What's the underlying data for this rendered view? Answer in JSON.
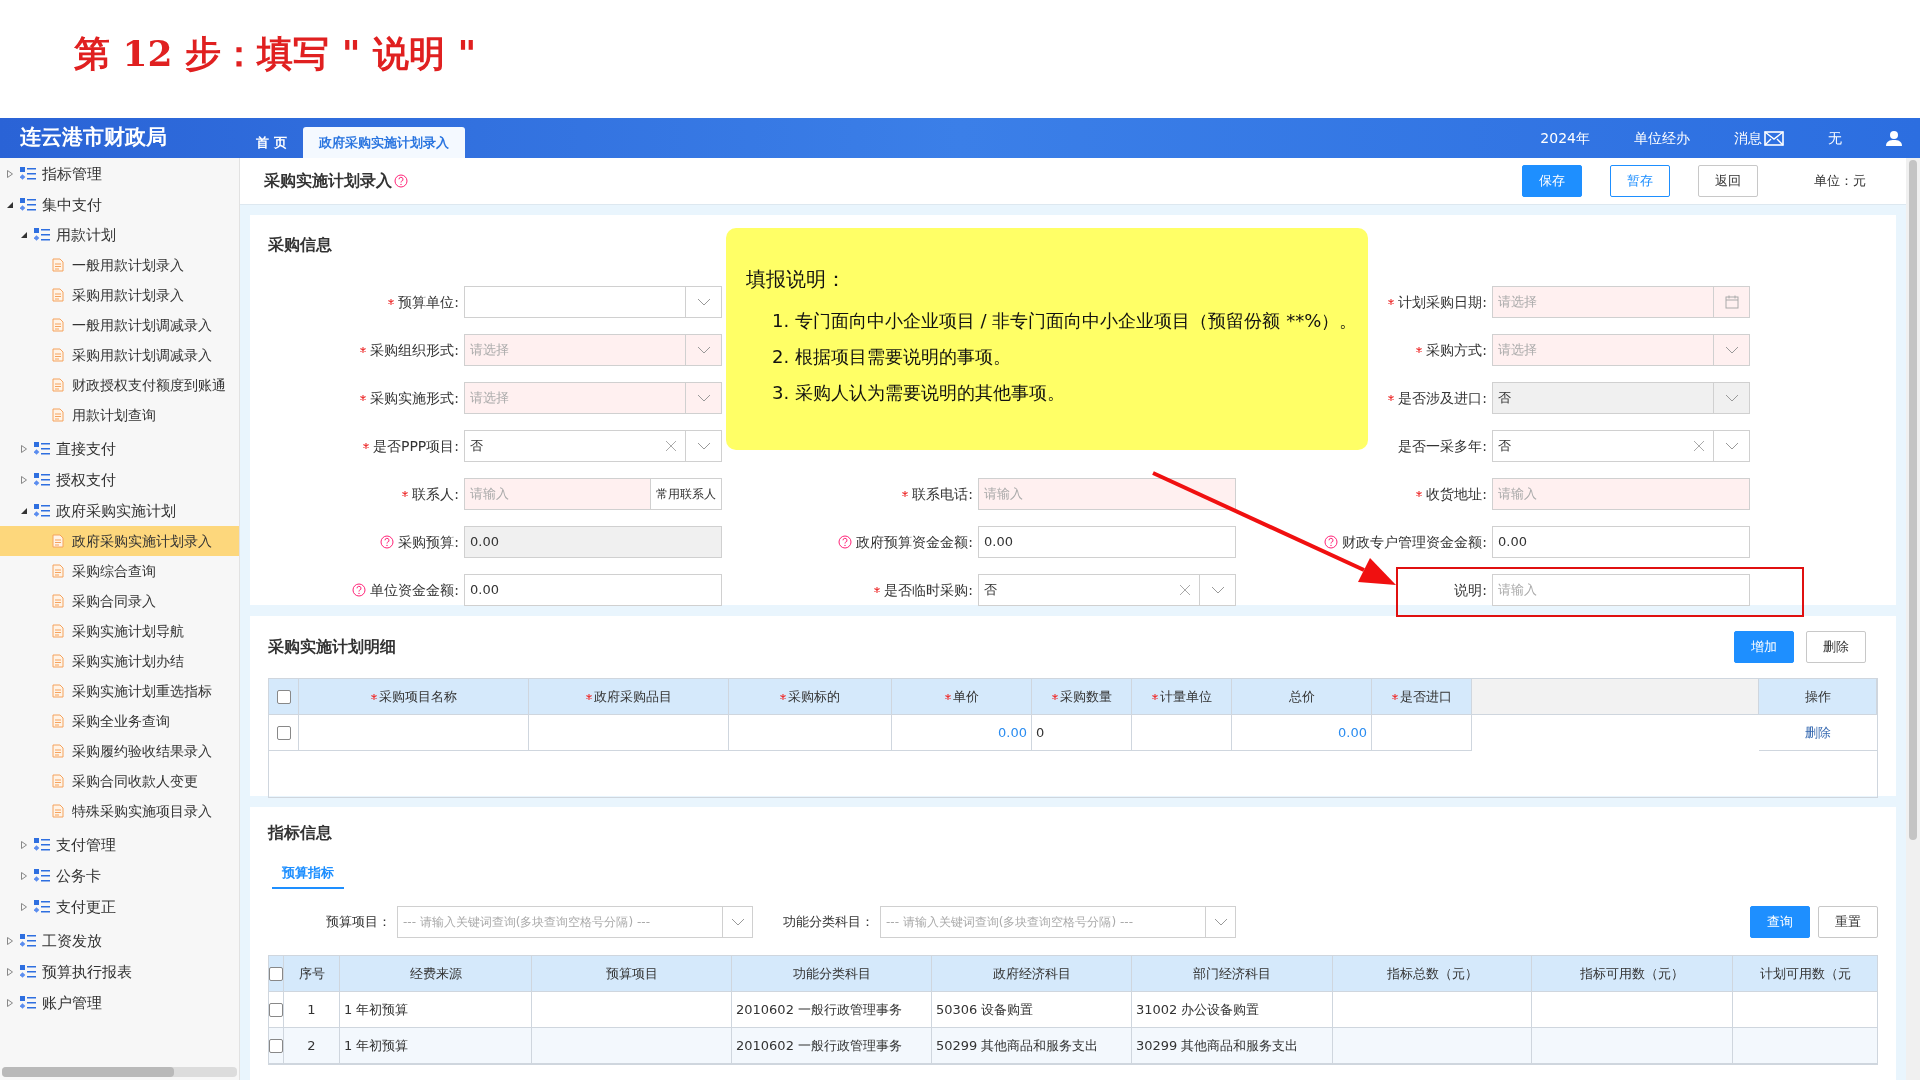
{
  "step_title": "第 12 步：填写 \" 说明 \"",
  "header": {
    "logo": "连云港市财政局",
    "tabs": [
      {
        "label": "首 页",
        "selected": false
      },
      {
        "label": "政府采购实施计划录入",
        "selected": true
      }
    ],
    "year": "2024年",
    "role": "单位经办",
    "messages": "消息",
    "extra": "无"
  },
  "sidebar": {
    "items": [
      {
        "label": "指标管理",
        "expanded": false
      },
      {
        "label": "集中支付",
        "expanded": true,
        "children": [
          {
            "label": "用款计划",
            "expanded": true,
            "children": [
              {
                "label": "一般用款计划录入",
                "selected": false
              },
              {
                "label": "采购用款计划录入",
                "selected": false
              },
              {
                "label": "一般用款计划调减录入",
                "selected": false
              },
              {
                "label": "采购用款计划调减录入",
                "selected": false
              },
              {
                "label": "财政授权支付额度到账通",
                "selected": false
              },
              {
                "label": "用款计划查询",
                "selected": false
              }
            ]
          },
          {
            "label": "直接支付",
            "expanded": false
          },
          {
            "label": "授权支付",
            "expanded": false
          },
          {
            "label": "政府采购实施计划",
            "expanded": true,
            "children": [
              {
                "label": "政府采购实施计划录入",
                "selected": true
              },
              {
                "label": "采购综合查询",
                "selected": false
              },
              {
                "label": "采购合同录入",
                "selected": false
              },
              {
                "label": "采购实施计划导航",
                "selected": false
              },
              {
                "label": "采购实施计划办结",
                "selected": false
              },
              {
                "label": "采购实施计划重选指标",
                "selected": false
              },
              {
                "label": "采购全业务查询",
                "selected": false
              },
              {
                "label": "采购履约验收结果录入",
                "selected": false
              },
              {
                "label": "采购合同收款人变更",
                "selected": false
              },
              {
                "label": "特殊采购实施项目录入",
                "selected": false
              }
            ]
          },
          {
            "label": "支付管理",
            "expanded": false
          },
          {
            "label": "公务卡",
            "expanded": false
          },
          {
            "label": "支付更正",
            "expanded": false
          }
        ]
      },
      {
        "label": "工资发放",
        "expanded": false
      },
      {
        "label": "预算执行报表",
        "expanded": false
      },
      {
        "label": "账户管理",
        "expanded": false
      }
    ]
  },
  "page": {
    "title": "采购实施计划录入",
    "buttons": [
      {
        "label": "保存",
        "kind": "primary"
      },
      {
        "label": "暂存",
        "kind": "outline"
      },
      {
        "label": "返回",
        "kind": "plain"
      }
    ],
    "unit": "单位：元"
  },
  "purchase_info": {
    "title": "采购信息",
    "columns": [
      [
        {
          "label": "预算单位:",
          "kind": "select",
          "required": true
        },
        {
          "label": "采购组织形式:",
          "kind": "select",
          "required": true,
          "placeholder": "请选择"
        },
        {
          "label": "采购实施形式:",
          "kind": "select",
          "required": true,
          "placeholder": "请选择"
        },
        {
          "label": "是否PPP项目:",
          "kind": "select",
          "required": true,
          "value": "否",
          "clearable": true
        },
        {
          "label": "联系人:",
          "kind": "input_button",
          "required": true,
          "placeholder": "请输入",
          "button": "常用联系人"
        },
        {
          "label": "采购预算:",
          "kind": "input",
          "help": true,
          "disabled": true,
          "value": "0.00"
        },
        {
          "label": "单位资金金额:",
          "kind": "input",
          "help": true,
          "value": "0.00"
        }
      ],
      [
        {
          "label": "联系电话:",
          "kind": "input",
          "required": true,
          "placeholder": "请输入"
        },
        {
          "label": "政府预算资金金额:",
          "kind": "input",
          "help": true,
          "value": "0.00"
        },
        {
          "label": "是否临时采购:",
          "kind": "select",
          "required": true,
          "value": "否",
          "clearable": true
        }
      ],
      [
        {
          "label": "计划采购日期:",
          "kind": "date",
          "required": true,
          "placeholder": "请选择"
        },
        {
          "label": "采购方式:",
          "kind": "select",
          "required": true,
          "placeholder": "请选择"
        },
        {
          "label": "是否涉及进口:",
          "kind": "select",
          "required": true,
          "value": "否",
          "disabled": true
        },
        {
          "label": "是否一采多年:",
          "kind": "select",
          "value": "否",
          "clearable": true
        },
        {
          "label": "收货地址:",
          "kind": "input",
          "required": true,
          "placeholder": "请输入"
        },
        {
          "label": "财政专户管理资金金额:",
          "kind": "input",
          "help": true,
          "value": "0.00"
        },
        {
          "label": "说明:",
          "kind": "input",
          "placeholder": "请输入",
          "highlighted": true
        }
      ]
    ],
    "note": {
      "title": "填报说明：",
      "items": [
        "1. 专门面向中小企业项目 / 非专门面向中小企业项目（预留份额 **%）。",
        "2. 根据项目需要说明的事项。",
        "3. 采购人认为需要说明的其他事项。"
      ]
    }
  },
  "detail": {
    "title": "采购实施计划明细",
    "buttons": [
      {
        "label": "增加",
        "kind": "primary"
      },
      {
        "label": "删除",
        "kind": "plain"
      }
    ],
    "columns": [
      {
        "label": "采购项目名称",
        "required": true
      },
      {
        "label": "政府采购品目",
        "required": true
      },
      {
        "label": "采购标的",
        "required": true
      },
      {
        "label": "单价",
        "required": true
      },
      {
        "label": "采购数量",
        "required": true
      },
      {
        "label": "计量单位",
        "required": true
      },
      {
        "label": "总价",
        "required": false
      },
      {
        "label": "是否进口",
        "required": true
      },
      {
        "label": "操作",
        "required": false
      }
    ],
    "rows": [
      {
        "checked": false,
        "unit_price": "0.00",
        "quantity": "0",
        "total": "0.00",
        "action": "删除"
      }
    ],
    "header_checked": false
  },
  "index_info": {
    "title": "指标信息",
    "tabs": [
      {
        "label": "预算指标",
        "selected": true
      }
    ],
    "filters": [
      {
        "label": "预算项目：",
        "placeholder": "--- 请输入关键词查询(多块查询空格号分隔) ---"
      },
      {
        "label": "功能分类科目：",
        "placeholder": "--- 请输入关键词查询(多块查询空格号分隔) ---"
      }
    ],
    "buttons": [
      {
        "label": "查询",
        "kind": "primary"
      },
      {
        "label": "重置",
        "kind": "plain"
      }
    ],
    "columns": [
      "序号",
      "经费来源",
      "预算项目",
      "功能分类科目",
      "政府经济科目",
      "部门经济科目",
      "指标总数（元）",
      "指标可用数（元）",
      "计划可用数（元"
    ],
    "header_checked": false,
    "rows": [
      {
        "checked": false,
        "cells": [
          "1",
          "1 年初预算",
          "",
          "2010602 一般行政管理事务",
          "50306 设备购置",
          "31002 办公设备购置",
          "",
          "",
          ""
        ]
      },
      {
        "checked": false,
        "cells": [
          "2",
          "1 年初预算",
          "",
          "2010602 一般行政管理事务",
          "50299 其他商品和服务支出",
          "30299 其他商品和服务支出",
          "",
          "",
          ""
        ]
      }
    ]
  }
}
